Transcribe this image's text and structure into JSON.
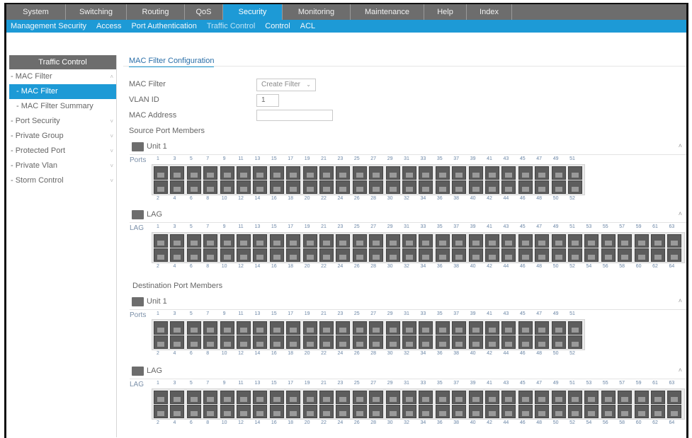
{
  "top_tabs": [
    {
      "label": "System",
      "active": false
    },
    {
      "label": "Switching",
      "active": false
    },
    {
      "label": "Routing",
      "active": false
    },
    {
      "label": "QoS",
      "active": false
    },
    {
      "label": "Security",
      "active": true
    },
    {
      "label": "Monitoring",
      "active": false
    },
    {
      "label": "Maintenance",
      "active": false
    },
    {
      "label": "Help",
      "active": false
    },
    {
      "label": "Index",
      "active": false
    }
  ],
  "sub_nav": [
    {
      "label": "Management Security",
      "active": false
    },
    {
      "label": "Access",
      "active": false
    },
    {
      "label": "Port Authentication",
      "active": false
    },
    {
      "label": "Traffic Control",
      "active": true
    },
    {
      "label": "Control",
      "active": false
    },
    {
      "label": "ACL",
      "active": false
    }
  ],
  "sidebar": {
    "title": "Traffic Control",
    "items": [
      {
        "label": "- MAC Filter",
        "type": "group",
        "expanded": true
      },
      {
        "label": "- MAC Filter",
        "type": "sub",
        "selected": true
      },
      {
        "label": "- MAC Filter Summary",
        "type": "sub",
        "selected": false
      },
      {
        "label": "- Port Security",
        "type": "group",
        "expanded": false
      },
      {
        "label": "- Private Group",
        "type": "group",
        "expanded": false
      },
      {
        "label": "- Protected Port",
        "type": "group",
        "expanded": false
      },
      {
        "label": "- Private Vlan",
        "type": "group",
        "expanded": false
      },
      {
        "label": "- Storm Control",
        "type": "group",
        "expanded": false
      }
    ]
  },
  "main": {
    "page_title": "MAC Filter Configuration",
    "fields": {
      "mac_filter_label": "MAC Filter",
      "mac_filter_value": "Create Filter",
      "vlan_id_label": "VLAN ID",
      "vlan_id_value": "1",
      "mac_address_label": "MAC Address",
      "mac_address_value": ""
    },
    "source_section": "Source Port Members",
    "destination_section": "Destination Port Members",
    "unit_label": "Unit 1",
    "lag_label": "LAG",
    "ports_row_label": "Ports",
    "lag_row_label": "LAG",
    "unit_odd_numbers": [
      "1",
      "3",
      "5",
      "7",
      "9",
      "11",
      "13",
      "15",
      "17",
      "19",
      "21",
      "23",
      "25",
      "27",
      "29",
      "31",
      "33",
      "35",
      "37",
      "39",
      "41",
      "43",
      "45",
      "47",
      "49",
      "51"
    ],
    "unit_even_numbers": [
      "2",
      "4",
      "6",
      "8",
      "10",
      "12",
      "14",
      "16",
      "18",
      "20",
      "22",
      "24",
      "26",
      "28",
      "30",
      "32",
      "34",
      "36",
      "38",
      "40",
      "42",
      "44",
      "46",
      "48",
      "50",
      "52"
    ],
    "lag_odd_numbers": [
      "1",
      "3",
      "5",
      "7",
      "9",
      "11",
      "13",
      "15",
      "17",
      "19",
      "21",
      "23",
      "25",
      "27",
      "29",
      "31",
      "33",
      "35",
      "37",
      "39",
      "41",
      "43",
      "45",
      "47",
      "49",
      "51",
      "53",
      "55",
      "57",
      "59",
      "61",
      "63"
    ],
    "lag_even_numbers": [
      "2",
      "4",
      "6",
      "8",
      "10",
      "12",
      "14",
      "16",
      "18",
      "20",
      "22",
      "24",
      "26",
      "28",
      "30",
      "32",
      "34",
      "36",
      "38",
      "40",
      "42",
      "44",
      "46",
      "48",
      "50",
      "52",
      "54",
      "56",
      "58",
      "60",
      "62",
      "64"
    ]
  },
  "colors": {
    "accent": "#1d9ad6",
    "tab_bar": "#6d6d6d",
    "port": "#5d5d5d"
  }
}
